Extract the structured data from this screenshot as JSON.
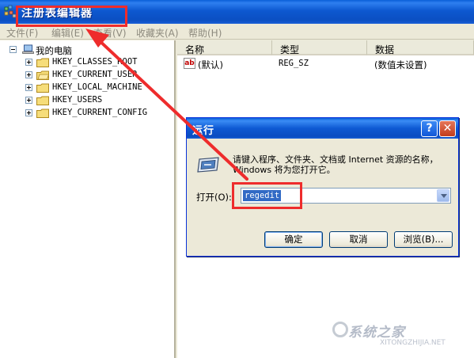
{
  "window": {
    "title": "注册表编辑器",
    "app_icon": "registry-editor-icon"
  },
  "menu": {
    "items": [
      "文件(F)",
      "编辑(E)",
      "查看(V)",
      "收藏夹(A)",
      "帮助(H)"
    ]
  },
  "tree": {
    "root": "我的电脑",
    "keys": [
      "HKEY_CLASSES_ROOT",
      "HKEY_CURRENT_USER",
      "HKEY_LOCAL_MACHINE",
      "HKEY_USERS",
      "HKEY_CURRENT_CONFIG"
    ]
  },
  "list": {
    "columns": [
      "名称",
      "类型",
      "数据"
    ],
    "rows": [
      {
        "name": "(默认)",
        "type": "REG_SZ",
        "data": "(数值未设置)"
      }
    ]
  },
  "run_dialog": {
    "title": "运行",
    "help_label": "?",
    "close_label": "✕",
    "description": "请键入程序、文件夹、文档或 Internet 资源的名称，Windows 将为您打开它。",
    "open_label": "打开(O):",
    "open_value": "regedit",
    "ok_label": "确定",
    "cancel_label": "取消",
    "browse_label": "浏览(B)..."
  },
  "watermark": {
    "text": "系统之家",
    "url": "XITONGZHIJIA.NET"
  },
  "colors": {
    "annotation_red": "#ee2c2c",
    "xp_blue": "#0b4fc2",
    "selection": "#316ac5"
  }
}
